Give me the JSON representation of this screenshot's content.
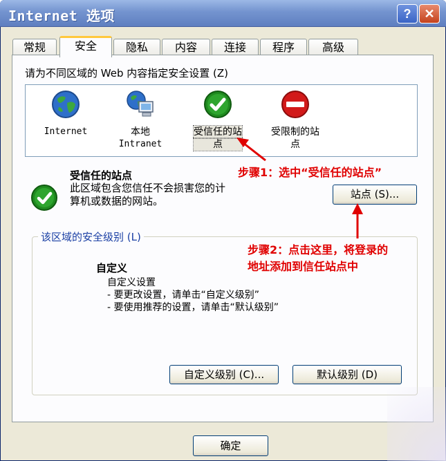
{
  "window": {
    "title": "Internet 选项",
    "help": "?",
    "close": "✕"
  },
  "tabs": [
    {
      "label": "常规"
    },
    {
      "label": "安全"
    },
    {
      "label": "隐私"
    },
    {
      "label": "内容"
    },
    {
      "label": "连接"
    },
    {
      "label": "程序"
    },
    {
      "label": "高级"
    }
  ],
  "security": {
    "zones_prompt": "请为不同区域的 Web 内容指定安全设置 (Z)",
    "zones": [
      {
        "line1": "Internet",
        "line2": "",
        "icon": "globe-icon"
      },
      {
        "line1": "本地",
        "line2": "Intranet",
        "icon": "computer-globe-icon"
      },
      {
        "line1": "受信任的站",
        "line2": "点",
        "icon": "green-check-icon"
      },
      {
        "line1": "受限制的站",
        "line2": "点",
        "icon": "red-no-entry-icon"
      }
    ],
    "selected_zone_title": "受信任的站点",
    "selected_zone_desc_1": "此区域包含您信任不会损害您的计",
    "selected_zone_desc_2": "算机或数据的网站。",
    "sites_button": "站点 (S)...",
    "level_group_label": "该区域的安全级别 (L)",
    "level_title": "自定义",
    "level_line1": "自定义设置",
    "level_line2": "- 要更改设置，请单击“自定义级别”",
    "level_line3": "- 要使用推荐的设置，请单击“默认级别”",
    "custom_level_button": "自定义级别 (C)...",
    "default_level_button": "默认级别 (D)"
  },
  "footer": {
    "ok_button": "确定"
  },
  "annotations": {
    "step1": "步骤1：选中“受信任的站点”",
    "step2_line1": "步骤2：点击这里，将登录的",
    "step2_line2": "地址添加到信任站点中"
  },
  "colors": {
    "annotation": "#e00000",
    "trusted": "#1f8a1f",
    "restricted": "#d21a1a",
    "title_bar": "#7393cf"
  }
}
